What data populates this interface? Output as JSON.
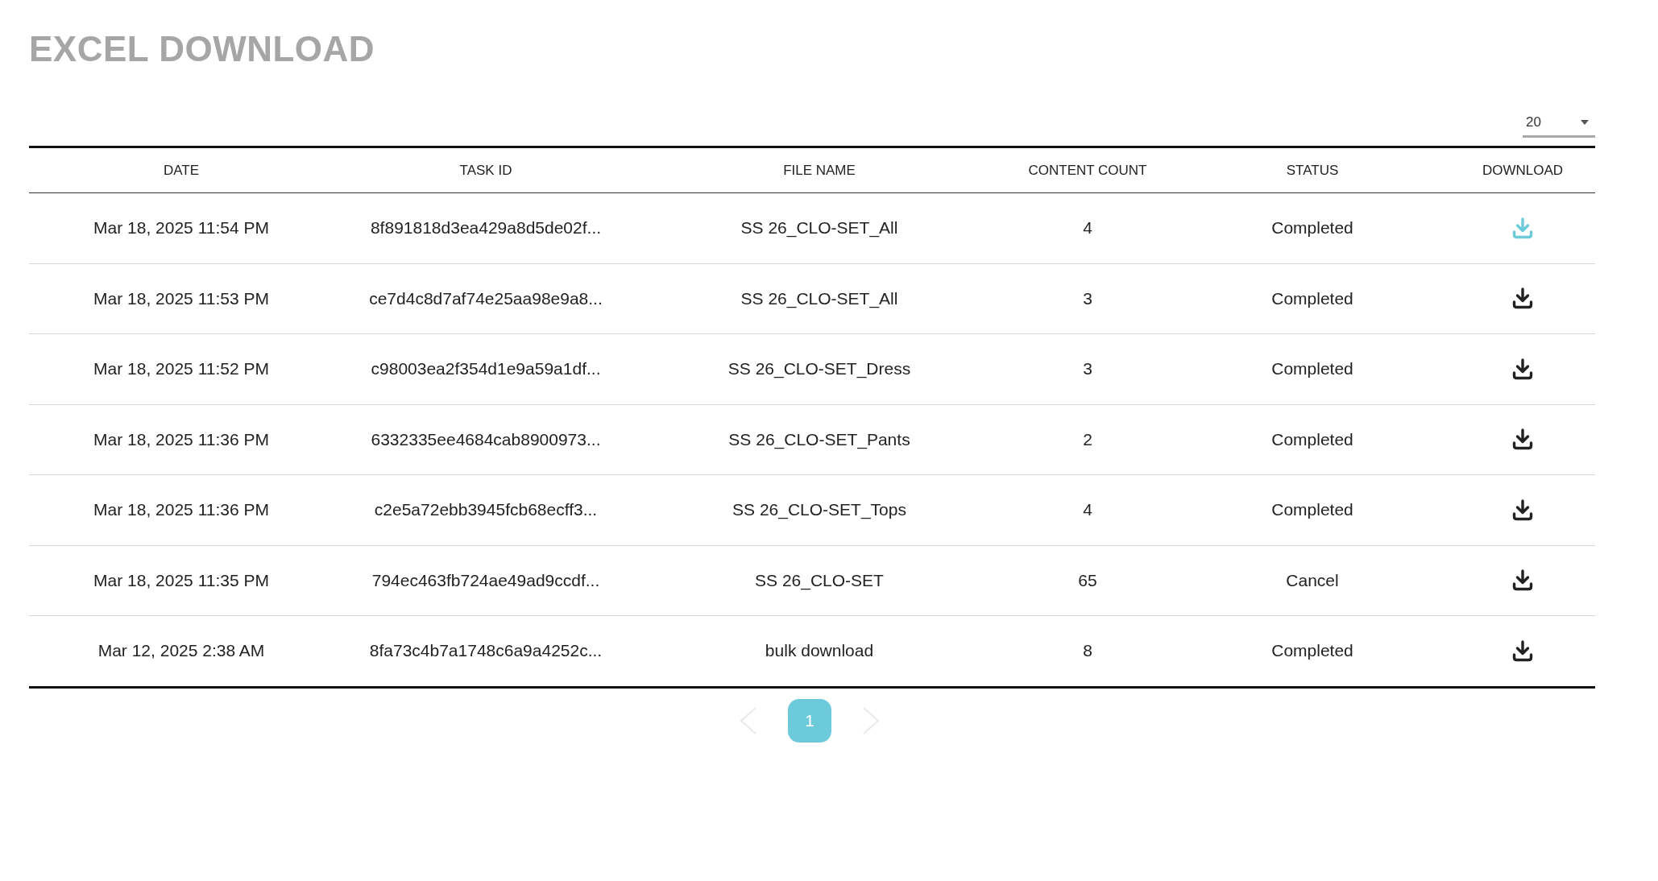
{
  "title": "EXCEL DOWNLOAD",
  "page_size": {
    "value": "20"
  },
  "table": {
    "columns": [
      "DATE",
      "TASK ID",
      "FILE NAME",
      "CONTENT COUNT",
      "STATUS",
      "DOWNLOAD"
    ],
    "rows": [
      {
        "date": "Mar 18, 2025 11:54 PM",
        "task_id": "8f891818d3ea429a8d5de02f...",
        "file_name": "SS 26_CLO-SET_All",
        "content_count": "4",
        "status": "Completed",
        "download_hovered": true
      },
      {
        "date": "Mar 18, 2025 11:53 PM",
        "task_id": "ce7d4c8d7af74e25aa98e9a8...",
        "file_name": "SS 26_CLO-SET_All",
        "content_count": "3",
        "status": "Completed",
        "download_hovered": false
      },
      {
        "date": "Mar 18, 2025 11:52 PM",
        "task_id": "c98003ea2f354d1e9a59a1df...",
        "file_name": "SS 26_CLO-SET_Dress",
        "content_count": "3",
        "status": "Completed",
        "download_hovered": false
      },
      {
        "date": "Mar 18, 2025 11:36 PM",
        "task_id": "6332335ee4684cab8900973...",
        "file_name": "SS 26_CLO-SET_Pants",
        "content_count": "2",
        "status": "Completed",
        "download_hovered": false
      },
      {
        "date": "Mar 18, 2025 11:36 PM",
        "task_id": "c2e5a72ebb3945fcb68ecff3...",
        "file_name": "SS 26_CLO-SET_Tops",
        "content_count": "4",
        "status": "Completed",
        "download_hovered": false
      },
      {
        "date": "Mar 18, 2025 11:35 PM",
        "task_id": "794ec463fb724ae49ad9ccdf...",
        "file_name": "SS 26_CLO-SET",
        "content_count": "65",
        "status": "Cancel",
        "download_hovered": false
      },
      {
        "date": "Mar 12, 2025 2:38 AM",
        "task_id": "8fa73c4b7a1748c6a9a4252c...",
        "file_name": "bulk download",
        "content_count": "8",
        "status": "Completed",
        "download_hovered": false
      }
    ]
  },
  "pagination": {
    "prev_disabled": true,
    "next_disabled": true,
    "pages": [
      {
        "label": "1",
        "selected": true
      }
    ]
  }
}
